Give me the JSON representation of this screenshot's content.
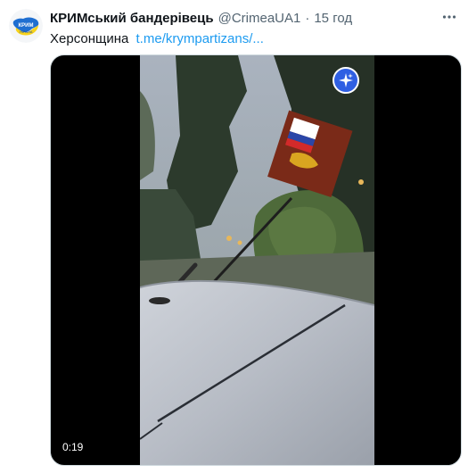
{
  "tweet": {
    "author_name": "КРИМський бандерівець",
    "author_handle": "@CrimeaUA1",
    "separator": "·",
    "time": "15 год",
    "text": "Херсонщина",
    "link": "t.me/krympartizans/...",
    "avatar_text": "КРИМ\nУКРАЇНА"
  },
  "media": {
    "duration": "0:19"
  },
  "colors": {
    "accent": "#1d9bf0",
    "secondary_text": "#536471",
    "sparkle_badge": "#2f5fe3"
  }
}
